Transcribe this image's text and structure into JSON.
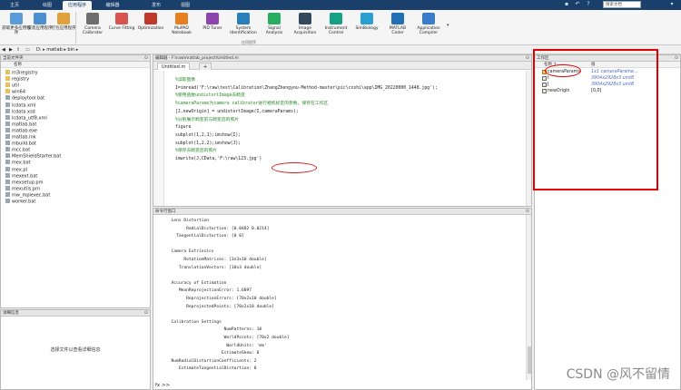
{
  "tabs": [
    {
      "label": "主页"
    },
    {
      "label": "绘图"
    },
    {
      "label": "应用程序"
    },
    {
      "label": "编辑器"
    },
    {
      "label": "发布"
    },
    {
      "label": "视图"
    }
  ],
  "search_placeholder": "搜索文档",
  "ribbon": {
    "buttons": [
      {
        "label": "获取更多应用程序",
        "icon": "plus-icon"
      },
      {
        "label": "安装应用程序",
        "icon": "install-icon"
      },
      {
        "label": "打包应用程序",
        "icon": "package-icon"
      },
      {
        "label": "Camera Calibrator",
        "icon": "camera-icon"
      },
      {
        "label": "Curve Fitting",
        "icon": "curve-fitting-icon"
      },
      {
        "label": "Optimization",
        "icon": "optimization-icon"
      },
      {
        "label": "MuPAD Notebook",
        "icon": "mupad-icon"
      },
      {
        "label": "PID Tuner",
        "icon": "pid-icon"
      },
      {
        "label": "System Identification",
        "icon": "sysid-icon"
      },
      {
        "label": "Signal Analysis",
        "icon": "signal-icon"
      },
      {
        "label": "Image Acquisition",
        "icon": "image-acq-icon"
      },
      {
        "label": "Instrument Control",
        "icon": "instrument-icon"
      },
      {
        "label": "SimBiology",
        "icon": "simbiology-icon"
      },
      {
        "label": "MATLAB Coder",
        "icon": "coder-icon"
      },
      {
        "label": "Application Compiler",
        "icon": "compiler-icon"
      }
    ],
    "section_label": "应用程序"
  },
  "address": {
    "path": "D: ▸ matlab ▸ bin ▸"
  },
  "current_folder": {
    "title": "当前文件夹",
    "column": "名称",
    "files": [
      {
        "name": "m3iregistry",
        "kind": "folder"
      },
      {
        "name": "registry",
        "kind": "folder"
      },
      {
        "name": "util",
        "kind": "folder"
      },
      {
        "name": "win64",
        "kind": "folder"
      },
      {
        "name": "deploytool.bat",
        "kind": "file"
      },
      {
        "name": "lcdata.xml",
        "kind": "file"
      },
      {
        "name": "lcdata.xsd",
        "kind": "file"
      },
      {
        "name": "lcdata_utf8.xml",
        "kind": "file"
      },
      {
        "name": "matlab.bat",
        "kind": "file"
      },
      {
        "name": "matlab.exe",
        "kind": "file"
      },
      {
        "name": "matlab.lnk",
        "kind": "file"
      },
      {
        "name": "mbuild.bat",
        "kind": "file"
      },
      {
        "name": "mcc.bat",
        "kind": "file"
      },
      {
        "name": "MemShieldStarter.bat",
        "kind": "file"
      },
      {
        "name": "mex.bat",
        "kind": "file"
      },
      {
        "name": "mex.pl",
        "kind": "file"
      },
      {
        "name": "mexext.bat",
        "kind": "file"
      },
      {
        "name": "mexsetup.pm",
        "kind": "file"
      },
      {
        "name": "mexutils.pm",
        "kind": "file"
      },
      {
        "name": "mw_mpiexec.bat",
        "kind": "file"
      },
      {
        "name": "worker.bat",
        "kind": "file"
      }
    ]
  },
  "details": {
    "title": "详细信息",
    "message": "选择文件以查看详细信息"
  },
  "editor": {
    "title": "编辑器 - F:\\raw\\matlab_project\\Untitled.m",
    "tab": "Untitled.m",
    "add_tab": "+",
    "lines": [
      {
        "text": "%读取图像",
        "type": "cm"
      },
      {
        "text": "I=imread('F:\\raw\\test\\Calibration\\ZhangZhengyou-Method-master\\pic\\cxshi\\app\\IMG_20220000_1448.jpg');",
        "type": "code"
      },
      {
        "text": "%使用函数undistortImage去畸变",
        "type": "cm"
      },
      {
        "text": "%cameraParams为camera calibrator进行相机标定的参数，保存在工作区",
        "type": "cm"
      },
      {
        "text": "[J,newOrigin] = undistortImage(I,cameraParams);",
        "type": "code"
      },
      {
        "text": "%分别展示畸变前与畸变后的照片",
        "type": "cm"
      },
      {
        "text": "figure",
        "type": "code"
      },
      {
        "text": "subplot(1,2,1);imshow(I);",
        "type": "code"
      },
      {
        "text": "subplot(1,2,2);imshow(J);",
        "type": "code"
      },
      {
        "text": "%保存去畸变后的照片",
        "type": "cm"
      },
      {
        "text": "imwrite(J,CData,'F:\\raw\\123.jpg')",
        "type": "code"
      }
    ]
  },
  "command_window": {
    "title": "命令行窗口",
    "prompt": "fx >>",
    "output": [
      "  Lens Distortion",
      "        RadialDistortion: [0.0482 0.0214]",
      "    TangentialDistortion: [0 0]",
      "",
      "  Camera Extrinsics",
      "       RotationMatrices: [3x3x10 double]",
      "     TranslationVectors: [10x3 double]",
      "",
      "  Accuracy of Estimation",
      "     MeanReprojectionError: 1.6897",
      "        ReprojectionErrors: [70x2x10 double]",
      "        ReprojectedPoints: [70x2x10 double]",
      "",
      "  Calibration Settings",
      "                       NumPatterns: 10",
      "                       WorldPoints: [70x2 double]",
      "                        WorldUnits: 'mm'",
      "                      EstimateSkew: 0",
      "  NumRadialDistortionCoefficients: 2",
      "     EstimateTangentialDistortion: 0"
    ]
  },
  "workspace": {
    "title": "工作区",
    "col_name": "名称 ↑",
    "col_value": "值",
    "vars": [
      {
        "name": "cameraParams",
        "value": "1x1 cameraParame...",
        "kind": "obj"
      },
      {
        "name": "I",
        "value": "3904x2928x3 uint8",
        "kind": "mat"
      },
      {
        "name": "J",
        "value": "3904x2928x3 uint8",
        "kind": "mat"
      },
      {
        "name": "newOrigin",
        "value": "[0,0]",
        "kind": "mat"
      }
    ]
  },
  "watermark": "CSDN @风不留情"
}
